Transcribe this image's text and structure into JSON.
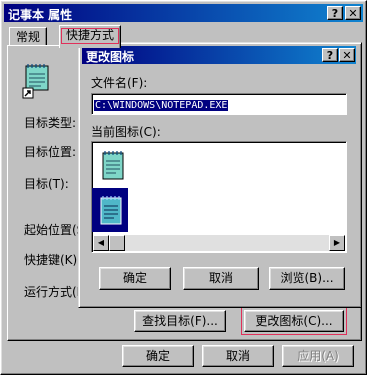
{
  "window": {
    "title": "记事本 属性",
    "help_glyph": "?",
    "close_glyph": "✕"
  },
  "tabs": [
    {
      "label": "常规"
    },
    {
      "label": "快捷方式"
    }
  ],
  "shortcut_panel": {
    "target_type_label": "目标类型:",
    "target_location_label": "目标位置:",
    "target_label": "目标(T):",
    "start_in_label": "起始位置(S):",
    "shortcut_key_label": "快捷键(K):",
    "run_label": "运行方式(R):",
    "find_target_button": "查找目标(F)...",
    "change_icon_button": "更改图标(C)..."
  },
  "footer": {
    "ok": "确定",
    "cancel": "取消",
    "apply": "应用(A)"
  },
  "dialog": {
    "title": "更改图标",
    "help_glyph": "?",
    "close_glyph": "✕",
    "filename_label": "文件名(F):",
    "filename_value": "C:\\WINDOWS\\NOTEPAD.EXE",
    "current_icon_label": "当前图标(C):",
    "ok": "确定",
    "cancel": "取消",
    "browse": "浏览(B)..."
  },
  "colors": {
    "title_bar": "#000080",
    "highlight_outline": "#e0305a",
    "selection": "#000080"
  }
}
